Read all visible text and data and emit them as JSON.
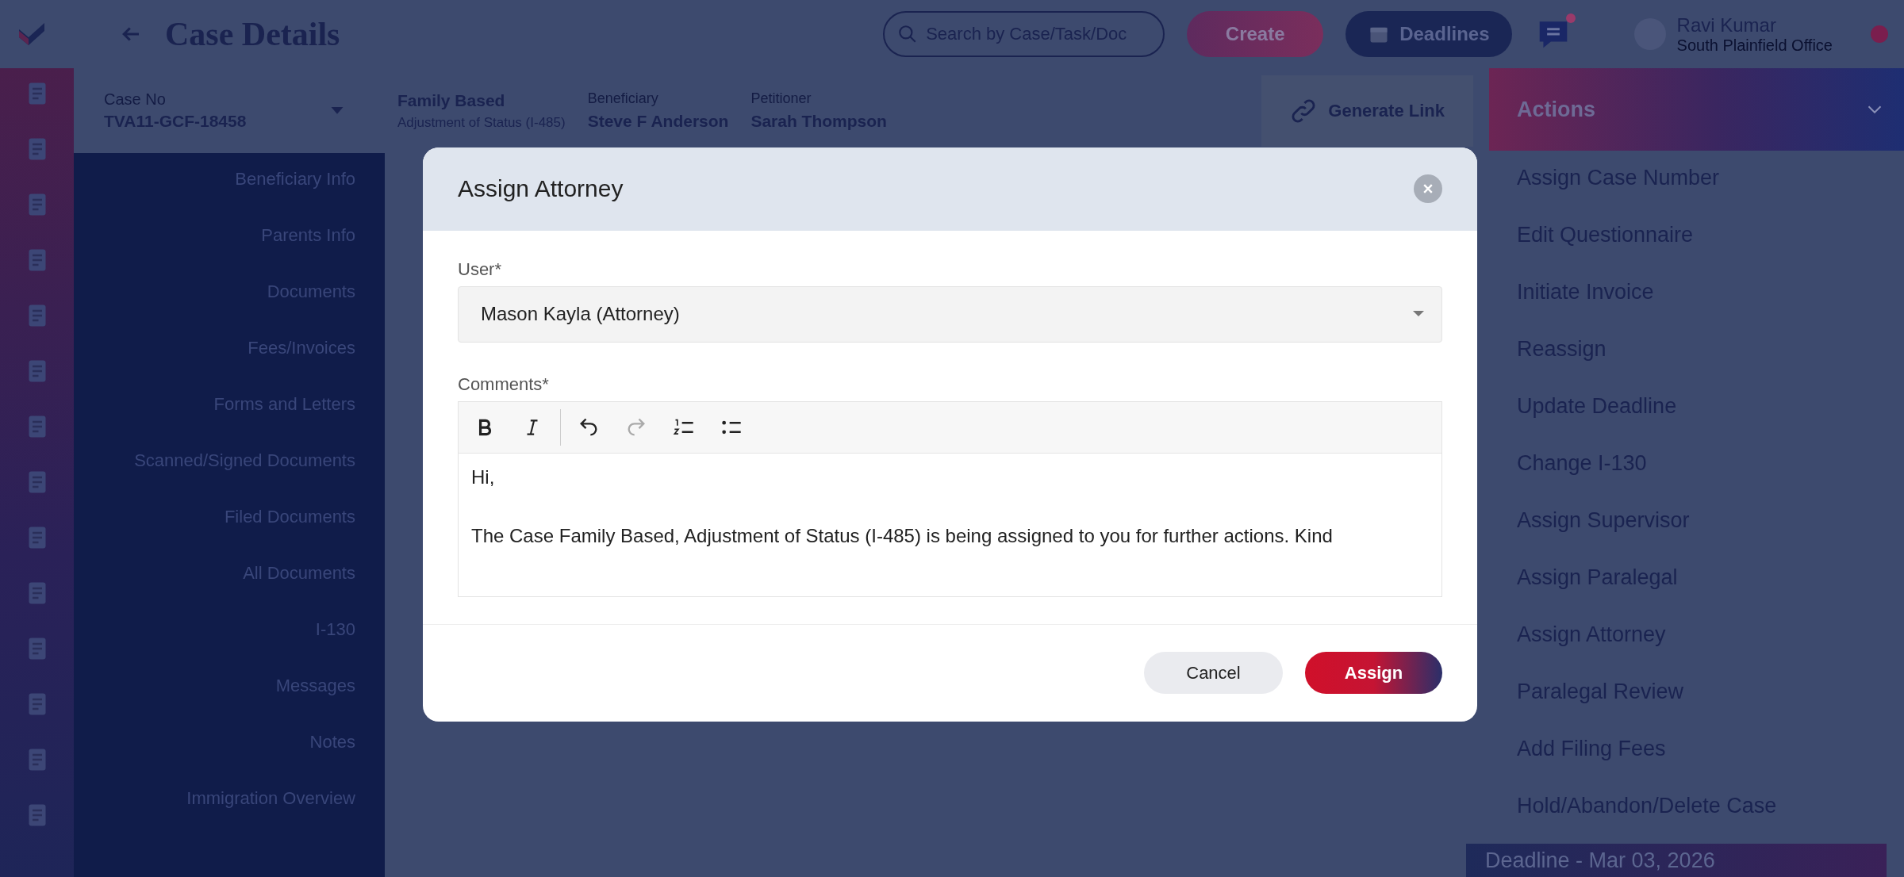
{
  "header": {
    "title": "Case Details",
    "search": {
      "placeholder": "Search by Case/Task/Doc"
    },
    "create_button": "Create",
    "deadlines_button": "Deadlines",
    "chat": {
      "unread": true
    },
    "user": {
      "name": "Ravi Kumar",
      "office": "South Plainfield Office"
    }
  },
  "case_bar": {
    "case_no_label": "Case No",
    "case_no": "TVA11-GCF-18458",
    "case_type": "Family Based",
    "case_subtype": "Adjustment of Status (I-485)",
    "beneficiary_label": "Beneficiary",
    "beneficiary": "Steve F Anderson",
    "petitioner_label": "Petitioner",
    "petitioner": "Sarah Thompson",
    "generate_link": "Generate Link"
  },
  "sidebar": {
    "items": [
      "Beneficiary Info",
      "Parents Info",
      "Documents",
      "Fees/Invoices",
      "Forms and Letters",
      "Scanned/Signed Documents",
      "Filed Documents",
      "All Documents",
      "I-130",
      "Messages",
      "Notes",
      "Immigration Overview"
    ]
  },
  "modal": {
    "title": "Assign Attorney",
    "user_label": "User*",
    "user_value": "Mason Kayla (Attorney)",
    "comments_label": "Comments*",
    "comments": [
      "Hi,",
      "The Case Family Based, Adjustment of Status (I-485) is being assigned to you for further actions. Kind"
    ],
    "cancel": "Cancel",
    "assign": "Assign"
  },
  "actions": {
    "title": "Actions",
    "items": [
      "Assign Case Number",
      "Edit Questionnaire",
      "Initiate Invoice",
      "Reassign",
      "Update Deadline",
      "Change I-130",
      "Assign Supervisor",
      "Assign Paralegal",
      "Assign Attorney",
      "Paralegal Review",
      "Add Filing Fees",
      "Hold/Abandon/Delete Case"
    ]
  },
  "deadline": "Deadline - Mar 03, 2026"
}
